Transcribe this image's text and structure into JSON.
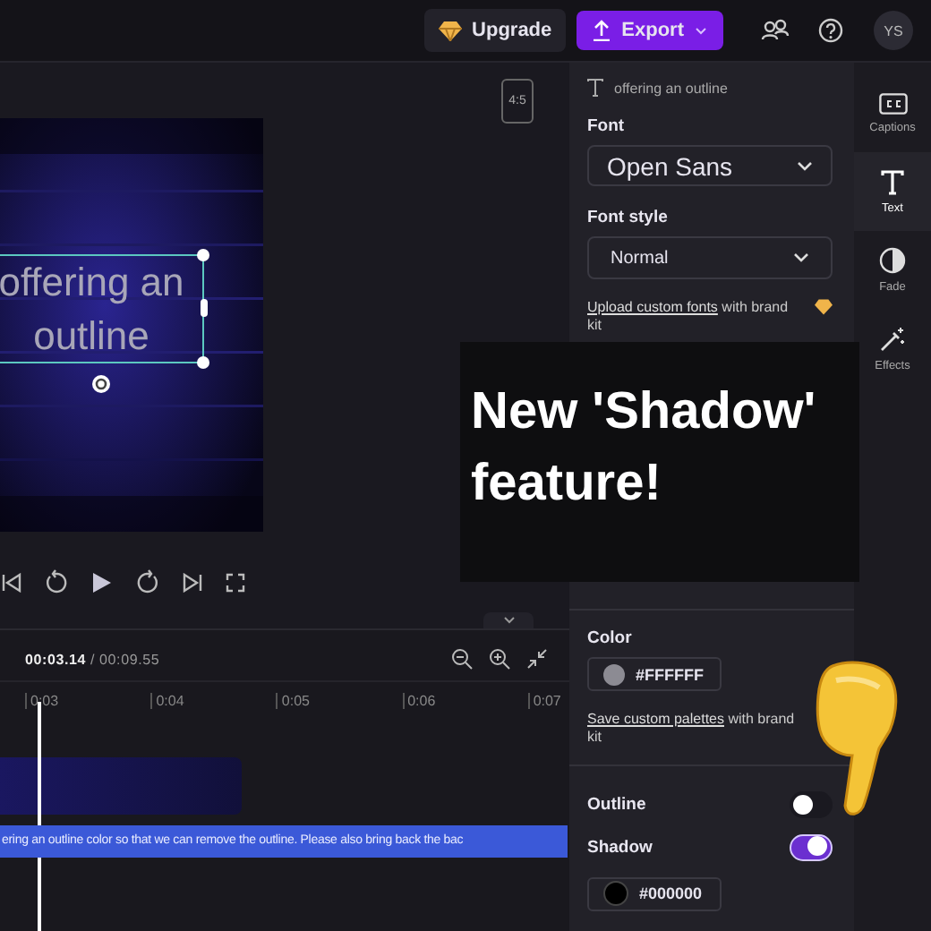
{
  "toolbar": {
    "upgrade": "Upgrade",
    "export": "Export",
    "avatar": "YS"
  },
  "preview": {
    "aspect_ratio": "4:5",
    "caption_text": "offering an outline"
  },
  "timeline": {
    "current_time": "00:03.14",
    "total_time": "/ 00:09.55",
    "ticks": [
      "0:03",
      "0:04",
      "0:05",
      "0:06",
      "0:07"
    ],
    "caption_clip": "ering an outline color so that we can remove the outline. Please also bring back the bac"
  },
  "panel": {
    "header": "offering an outline",
    "font_label": "Font",
    "font": "Open Sans",
    "font_style_label": "Font style",
    "font_style": "Normal",
    "fonts_note": {
      "link": "Upload custom fonts",
      "rest": "with brand kit"
    },
    "color_label": "Color",
    "color_value": "#FFFFFF",
    "palettes_note": {
      "link": "Save custom palettes",
      "rest": "with brand kit"
    },
    "toggles": [
      {
        "label": "Outline",
        "on": false
      },
      {
        "label": "Shadow",
        "on": true,
        "color_value": "#000000"
      }
    ]
  },
  "rail": [
    {
      "label": "Captions",
      "selected": false
    },
    {
      "label": "Text",
      "selected": true
    },
    {
      "label": "Fade",
      "selected": false
    },
    {
      "label": "Effects",
      "selected": false
    }
  ],
  "overlay": {
    "text": "New 'Shadow' feature!"
  }
}
